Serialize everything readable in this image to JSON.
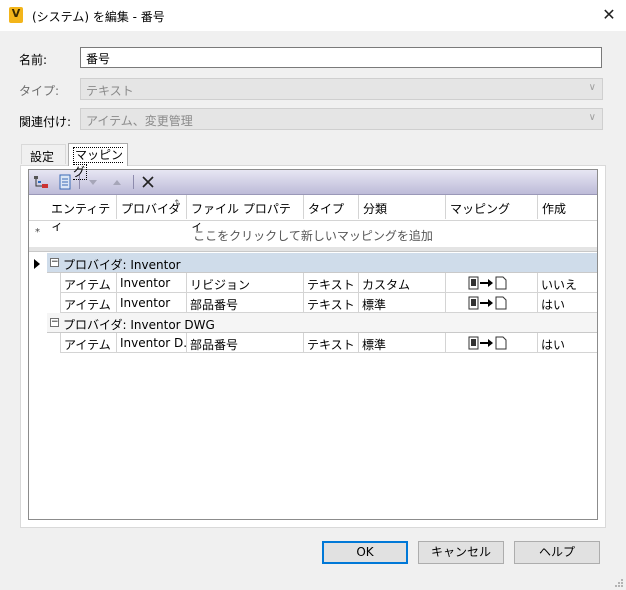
{
  "window": {
    "title": "(システム) を編集 - 番号",
    "app_icon_letter": "V",
    "close_glyph": "✕"
  },
  "form": {
    "name_label": "名前:",
    "name_value": "番号",
    "type_label": "タイプ:",
    "type_value": "テキスト",
    "association_label": "関連付け:",
    "association_value": "アイテム、変更管理"
  },
  "tabs": [
    {
      "label": "設定",
      "selected": false
    },
    {
      "label": "マッピング",
      "selected": true
    }
  ],
  "grid": {
    "columns": [
      "エンティティ",
      "プロバイダ",
      "ファイル プロパティ",
      "タイプ",
      "分類",
      "マッピング",
      "作成"
    ],
    "sort_indicator": "↑",
    "new_row_marker": "*",
    "new_row_hint": "ここをクリックして新しいマッピングを追加",
    "groups": [
      {
        "label": "プロバイダ: Inventor",
        "expander": "⊟",
        "rows": [
          {
            "entity": "アイテム",
            "provider": "Inventor",
            "file_property": "リビジョン",
            "type": "テキスト",
            "category": "カスタム",
            "create": "いいえ"
          },
          {
            "entity": "アイテム",
            "provider": "Inventor",
            "file_property": "部品番号",
            "type": "テキスト",
            "category": "標準",
            "create": "はい"
          }
        ]
      },
      {
        "label": "プロバイダ: Inventor DWG",
        "expander": "⊟",
        "rows": [
          {
            "entity": "アイテム",
            "provider": "Inventor D...",
            "file_property": "部品番号",
            "type": "テキスト",
            "category": "標準",
            "create": "はい"
          }
        ]
      }
    ]
  },
  "buttons": {
    "ok": "OK",
    "cancel": "キャンセル",
    "help": "ヘルプ"
  },
  "colors": {
    "default_button_border": "#0078d7",
    "toolbar_top": "#e7e6f3",
    "toolbar_bottom": "#bdbbd8",
    "group_active": "#cfdcea",
    "app_icon": "#f3b51a"
  }
}
